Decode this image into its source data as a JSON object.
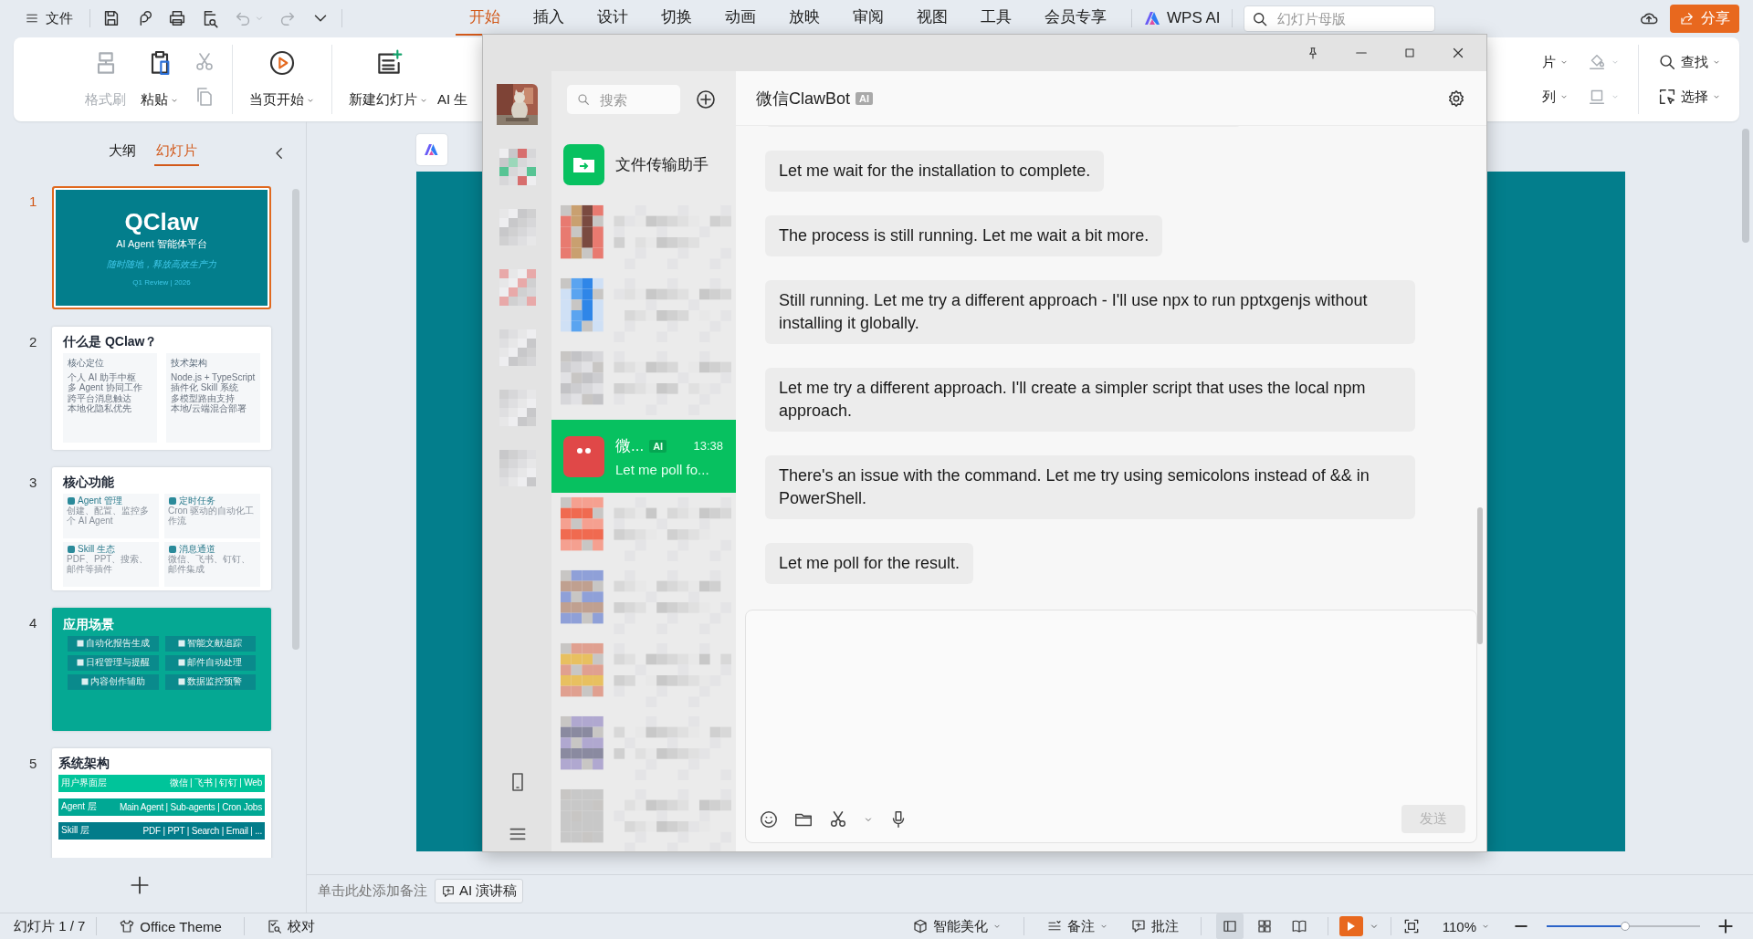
{
  "menu": {
    "label": "文件"
  },
  "quick_access": [
    {
      "kind": "save",
      "disabled": false,
      "dropdown": false
    },
    {
      "kind": "loop",
      "disabled": false,
      "dropdown": false
    },
    {
      "kind": "print",
      "disabled": false,
      "dropdown": false
    },
    {
      "kind": "preview",
      "disabled": false,
      "dropdown": false
    },
    {
      "kind": "undo",
      "disabled": true,
      "dropdown": true
    },
    {
      "kind": "redo",
      "disabled": true,
      "dropdown": false
    },
    {
      "kind": "more",
      "disabled": false,
      "dropdown": false
    }
  ],
  "tabs": [
    {
      "label": "开始",
      "selected": true
    },
    {
      "label": "插入",
      "selected": false
    },
    {
      "label": "设计",
      "selected": false
    },
    {
      "label": "切换",
      "selected": false
    },
    {
      "label": "动画",
      "selected": false
    },
    {
      "label": "放映",
      "selected": false
    },
    {
      "label": "审阅",
      "selected": false
    },
    {
      "label": "视图",
      "selected": false
    },
    {
      "label": "工具",
      "selected": false
    },
    {
      "label": "会员专享",
      "selected": false
    }
  ],
  "wps_ai": {
    "label": "WPS AI"
  },
  "search": {
    "placeholder": "幻灯片母版"
  },
  "share_button": {
    "label": "分享"
  },
  "ribbon": {
    "left": [
      {
        "kind": "format-painter",
        "label": "格式刷",
        "disabled": true,
        "dropdown": false
      },
      {
        "kind": "paste",
        "label": "粘贴",
        "disabled": false,
        "dropdown": true
      },
      {
        "kind": "cut-copy",
        "disabled": true
      },
      {
        "kind": "separator"
      },
      {
        "kind": "play",
        "label": "当页开始",
        "disabled": false,
        "dropdown": true
      },
      {
        "kind": "separator"
      },
      {
        "kind": "new-slide",
        "label": "新建幻灯片",
        "disabled": false,
        "dropdown": true
      },
      {
        "kind": "text-only",
        "label": "AI 生",
        "disabled": false
      }
    ],
    "right": [
      {
        "kind": "label",
        "label": "片",
        "disabled": false,
        "dropdown": true
      },
      {
        "kind": "label",
        "label": "列",
        "disabled": false,
        "dropdown": true
      },
      {
        "kind": "fill",
        "disabled": true,
        "dropdown": true
      },
      {
        "kind": "outline",
        "disabled": true,
        "dropdown": true
      },
      {
        "kind": "find",
        "label": "查找",
        "disabled": false,
        "dropdown": true
      },
      {
        "kind": "select",
        "label": "选择",
        "disabled": false,
        "dropdown": true
      }
    ]
  },
  "panel_tabs": [
    {
      "label": "大纲",
      "selected": false
    },
    {
      "label": "幻灯片",
      "selected": true
    }
  ],
  "slides": [
    {
      "number": "1",
      "selected": true,
      "kind": "title",
      "title": "QClaw",
      "subtitle": "AI Agent 智能体平台",
      "tagline": "随时随地，释放高效生产力",
      "footer": "Q1 Review | 2026"
    },
    {
      "number": "2",
      "selected": false,
      "kind": "two-column",
      "title": "什么是 QClaw？",
      "columns": [
        {
          "heading": "核心定位",
          "bullets": [
            "个人 AI 助手中枢",
            "多 Agent 协同工作",
            "跨平台消息触达",
            "本地化隐私优先"
          ]
        },
        {
          "heading": "技术架构",
          "bullets": [
            "Node.js + TypeScript",
            "插件化 Skill 系统",
            "多模型路由支持",
            "本地/云端混合部署"
          ]
        }
      ]
    },
    {
      "number": "3",
      "selected": false,
      "kind": "card-grid",
      "title": "核心功能",
      "cards": [
        {
          "heading": "Agent 管理",
          "text": "创建、配置、监控多个 AI Agent"
        },
        {
          "heading": "定时任务",
          "text": "Cron 驱动的自动化工作流"
        },
        {
          "heading": "Skill 生态",
          "text": "PDF、PPT、搜索、邮件等插件"
        },
        {
          "heading": "消息通道",
          "text": "微信、飞书、钉钉、邮件集成"
        }
      ]
    },
    {
      "number": "4",
      "selected": false,
      "kind": "button-grid",
      "title": "应用场景",
      "buttons": [
        "自动化报告生成",
        "智能文献追踪",
        "日程管理与提醒",
        "邮件自动处理",
        "内容创作辅助",
        "数据监控预警"
      ]
    },
    {
      "number": "5",
      "selected": false,
      "kind": "layer-stack",
      "title": "系统架构",
      "layers": [
        {
          "name": "用户界面层",
          "detail": "微信 | 飞书 | 钉钉 | Web",
          "color": "#00c49a"
        },
        {
          "name": "Agent 层",
          "detail": "Main Agent | Sub-agents | Cron Jobs",
          "color": "#00a894"
        },
        {
          "name": "Skill 层",
          "detail": "PDF | PPT | Search | Email | ...",
          "color": "#027c8a"
        }
      ]
    }
  ],
  "notes": {
    "hint": "单击此处添加备注",
    "ai_button": "AI 演讲稿"
  },
  "status_bar": {
    "slide_count": "幻灯片 1 / 7",
    "theme": "Office Theme",
    "proofing": "校对",
    "beautify": "智能美化",
    "notes": "备注",
    "comments": "批注",
    "views": [
      {
        "kind": "normal",
        "selected": true
      },
      {
        "kind": "sorter",
        "selected": false
      },
      {
        "kind": "reading",
        "selected": false
      }
    ],
    "zoom": "110%",
    "zoom_slider": {
      "level": 0.51
    }
  },
  "chat_window": {
    "nav": [
      {
        "kind": "avatar"
      },
      {
        "kind": "redacted"
      },
      {
        "kind": "redacted"
      },
      {
        "kind": "redacted"
      },
      {
        "kind": "redacted"
      },
      {
        "kind": "redacted"
      },
      {
        "kind": "redacted"
      },
      {
        "kind": "phone"
      },
      {
        "kind": "menu"
      }
    ],
    "search": {
      "placeholder": "搜索"
    },
    "chats": [
      {
        "kind": "file-transfer",
        "name": "文件传输助手",
        "selected": false
      },
      {
        "kind": "redacted",
        "selected": false
      },
      {
        "kind": "redacted",
        "selected": false
      },
      {
        "kind": "redacted",
        "selected": false
      },
      {
        "kind": "bot",
        "name": "微...",
        "badge": "AI",
        "time": "13:38",
        "preview": "Let me poll fo...",
        "selected": true
      },
      {
        "kind": "redacted",
        "selected": false
      },
      {
        "kind": "redacted",
        "selected": false
      },
      {
        "kind": "redacted",
        "selected": false
      },
      {
        "kind": "redacted",
        "selected": false
      },
      {
        "kind": "redacted",
        "selected": false
      }
    ],
    "title": "微信ClawBot",
    "title_badge": "AI",
    "messages": [
      {
        "kind": "cut-off"
      },
      {
        "kind": "text",
        "text": "Let me wait for the installation to complete."
      },
      {
        "kind": "text",
        "text": "The process is still running. Let me wait a bit more."
      },
      {
        "kind": "text",
        "text": "Still running. Let me try a different approach - I'll use npx to run pptxgenjs without installing it globally."
      },
      {
        "kind": "text",
        "text": "Let me try a different approach. I'll create a simpler script that uses the local npm approach."
      },
      {
        "kind": "text",
        "text": "There's an issue with the command. Let me try using semicolons instead of && in PowerShell."
      },
      {
        "kind": "text",
        "text": "Let me poll for the result."
      }
    ],
    "send_button": {
      "label": "发送",
      "disabled": true
    }
  }
}
